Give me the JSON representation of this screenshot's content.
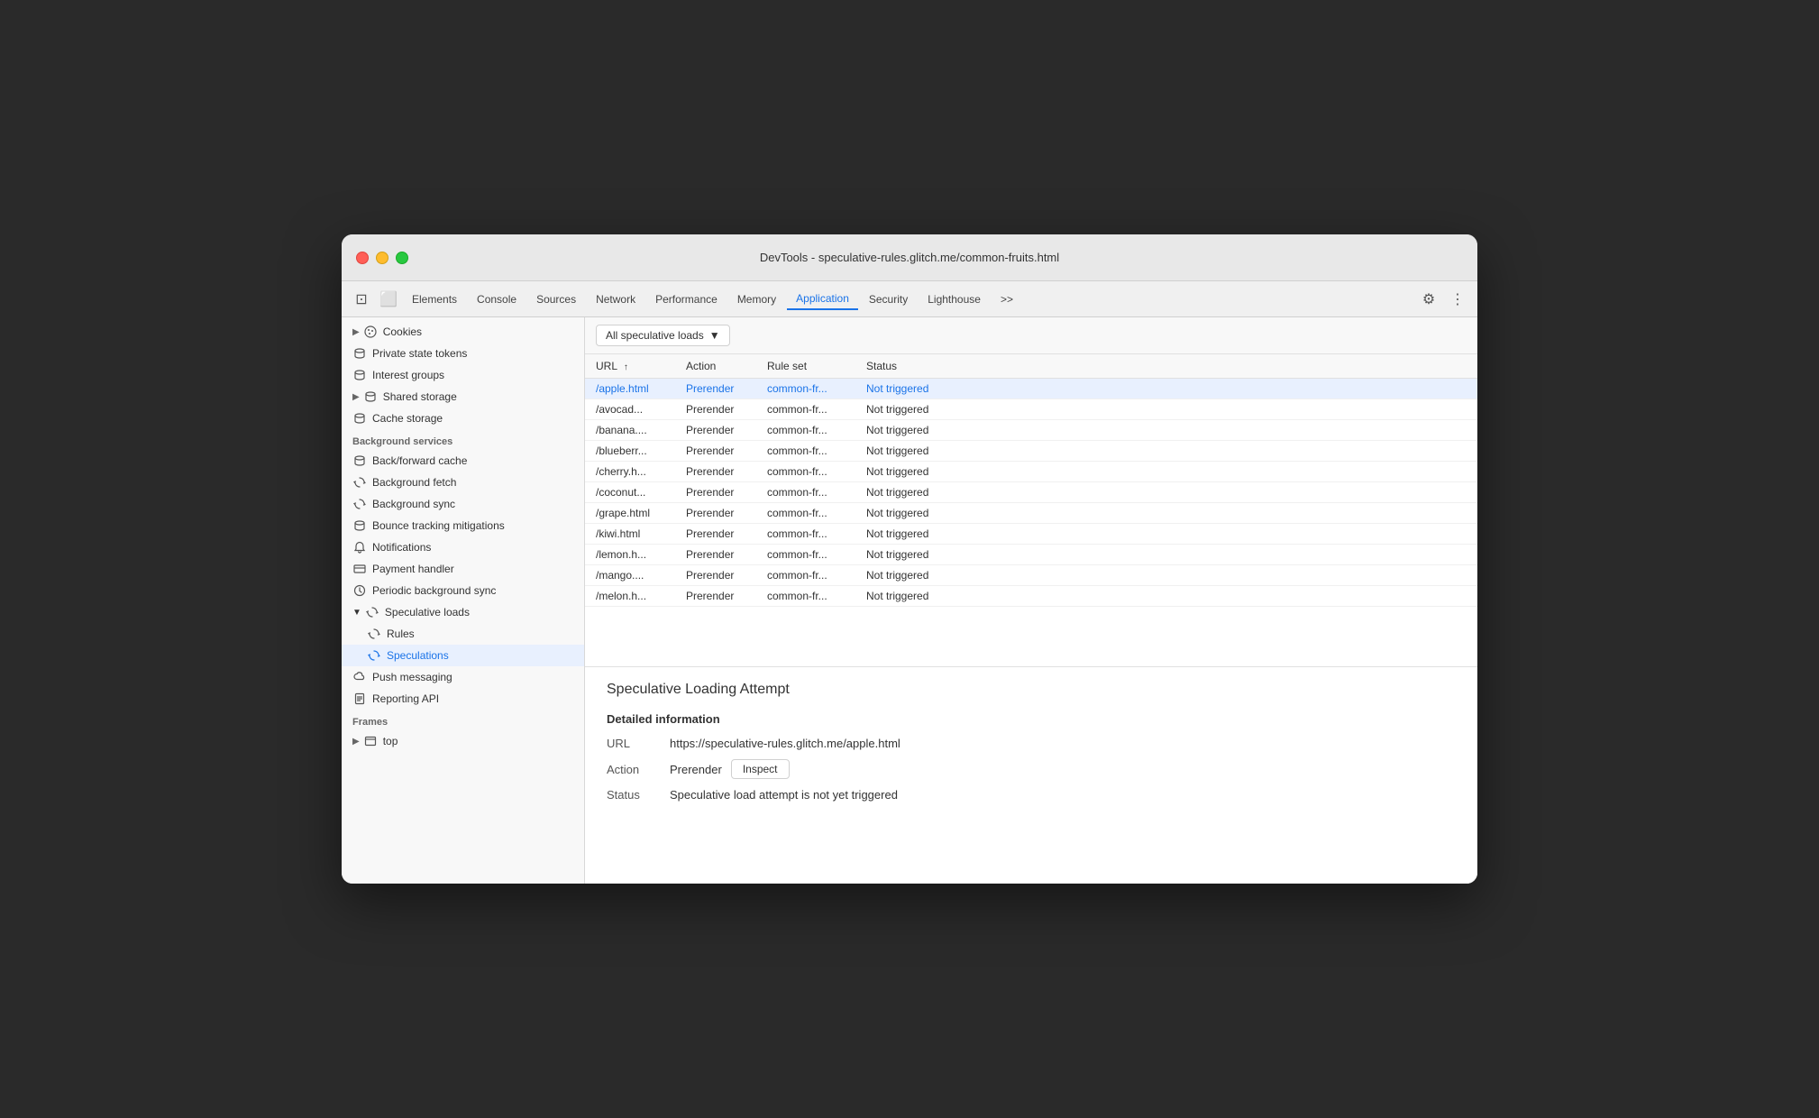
{
  "window": {
    "title": "DevTools - speculative-rules.glitch.me/common-fruits.html"
  },
  "tabs": {
    "items": [
      {
        "label": "Elements",
        "active": false
      },
      {
        "label": "Console",
        "active": false
      },
      {
        "label": "Sources",
        "active": false
      },
      {
        "label": "Network",
        "active": false
      },
      {
        "label": "Performance",
        "active": false
      },
      {
        "label": "Memory",
        "active": false
      },
      {
        "label": "Application",
        "active": true
      },
      {
        "label": "Security",
        "active": false
      },
      {
        "label": "Lighthouse",
        "active": false
      }
    ],
    "more_label": ">>",
    "gear_icon": "⚙",
    "dots_icon": "⋮"
  },
  "sidebar": {
    "sections": [
      {
        "items": [
          {
            "label": "Cookies",
            "icon": "cookie",
            "expandable": true,
            "indent": 0
          },
          {
            "label": "Private state tokens",
            "icon": "db",
            "indent": 0
          },
          {
            "label": "Interest groups",
            "icon": "db",
            "indent": 0
          },
          {
            "label": "Shared storage",
            "icon": "db",
            "expandable": true,
            "indent": 0
          },
          {
            "label": "Cache storage",
            "icon": "db",
            "indent": 0
          }
        ]
      },
      {
        "label": "Background services",
        "items": [
          {
            "label": "Back/forward cache",
            "icon": "db",
            "indent": 0
          },
          {
            "label": "Background fetch",
            "icon": "sync",
            "indent": 0
          },
          {
            "label": "Background sync",
            "icon": "sync",
            "indent": 0
          },
          {
            "label": "Bounce tracking mitigations",
            "icon": "db",
            "indent": 0
          },
          {
            "label": "Notifications",
            "icon": "bell",
            "indent": 0
          },
          {
            "label": "Payment handler",
            "icon": "card",
            "indent": 0
          },
          {
            "label": "Periodic background sync",
            "icon": "clock",
            "indent": 0
          },
          {
            "label": "Speculative loads",
            "icon": "sync",
            "expandable": true,
            "expanded": true,
            "indent": 0
          },
          {
            "label": "Rules",
            "icon": "sync",
            "indent": 1
          },
          {
            "label": "Speculations",
            "icon": "sync",
            "indent": 1,
            "active": true
          },
          {
            "label": "Push messaging",
            "icon": "cloud",
            "indent": 0
          },
          {
            "label": "Reporting API",
            "icon": "doc",
            "indent": 0
          }
        ]
      },
      {
        "label": "Frames",
        "items": [
          {
            "label": "top",
            "icon": "frame",
            "expandable": true,
            "indent": 0
          }
        ]
      }
    ]
  },
  "filter": {
    "dropdown_label": "All speculative loads",
    "dropdown_icon": "▼"
  },
  "table": {
    "columns": [
      {
        "label": "URL",
        "sort": true
      },
      {
        "label": "Action"
      },
      {
        "label": "Rule set"
      },
      {
        "label": "Status"
      }
    ],
    "rows": [
      {
        "url": "/apple.html",
        "action": "Prerender",
        "ruleset": "common-fr...",
        "status": "Not triggered",
        "selected": true
      },
      {
        "url": "/avocad...",
        "action": "Prerender",
        "ruleset": "common-fr...",
        "status": "Not triggered"
      },
      {
        "url": "/banana....",
        "action": "Prerender",
        "ruleset": "common-fr...",
        "status": "Not triggered"
      },
      {
        "url": "/blueberr...",
        "action": "Prerender",
        "ruleset": "common-fr...",
        "status": "Not triggered"
      },
      {
        "url": "/cherry.h...",
        "action": "Prerender",
        "ruleset": "common-fr...",
        "status": "Not triggered"
      },
      {
        "url": "/coconut...",
        "action": "Prerender",
        "ruleset": "common-fr...",
        "status": "Not triggered"
      },
      {
        "url": "/grape.html",
        "action": "Prerender",
        "ruleset": "common-fr...",
        "status": "Not triggered"
      },
      {
        "url": "/kiwi.html",
        "action": "Prerender",
        "ruleset": "common-fr...",
        "status": "Not triggered"
      },
      {
        "url": "/lemon.h...",
        "action": "Prerender",
        "ruleset": "common-fr...",
        "status": "Not triggered"
      },
      {
        "url": "/mango....",
        "action": "Prerender",
        "ruleset": "common-fr...",
        "status": "Not triggered"
      },
      {
        "url": "/melon.h...",
        "action": "Prerender",
        "ruleset": "common-fr...",
        "status": "Not triggered"
      }
    ]
  },
  "detail": {
    "title": "Speculative Loading Attempt",
    "section_label": "Detailed information",
    "url_label": "URL",
    "url_value": "https://speculative-rules.glitch.me/apple.html",
    "action_label": "Action",
    "action_value": "Prerender",
    "inspect_label": "Inspect",
    "status_label": "Status",
    "status_value": "Speculative load attempt is not yet triggered"
  }
}
